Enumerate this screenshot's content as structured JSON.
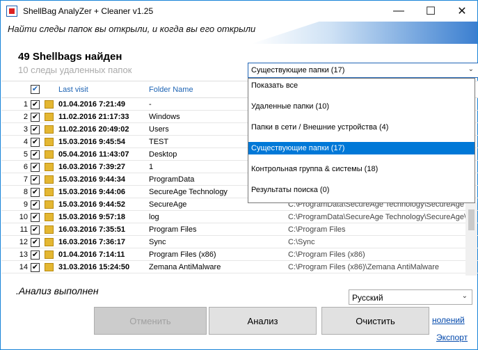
{
  "window": {
    "title": "ShellBag  AnalyZer + Cleaner v1.25"
  },
  "header": {
    "subtitle": "Найти следы папок вы открыли, и когда вы его открыли",
    "count_title": "49 Shellbags найден",
    "deleted_count": "10  следы удаленных папок"
  },
  "grid": {
    "col_last_visit": "Last visit",
    "col_folder_name": "Folder Name",
    "header_check": "✔",
    "rows": [
      {
        "n": "1",
        "visit": "01.04.2016 7:21:49",
        "name": "-",
        "path": ""
      },
      {
        "n": "2",
        "visit": "11.02.2016 21:17:33",
        "name": "Windows",
        "path": ""
      },
      {
        "n": "3",
        "visit": "11.02.2016 20:49:02",
        "name": "Users",
        "path": ""
      },
      {
        "n": "4",
        "visit": "15.03.2016 9:45:54",
        "name": "TEST",
        "path": ""
      },
      {
        "n": "5",
        "visit": "05.04.2016 11:43:07",
        "name": "Desktop",
        "path": ""
      },
      {
        "n": "6",
        "visit": "16.03.2016 7:39:27",
        "name": "1",
        "path": ""
      },
      {
        "n": "7",
        "visit": "15.03.2016 9:44:34",
        "name": "ProgramData",
        "path": ""
      },
      {
        "n": "8",
        "visit": "15.03.2016 9:44:06",
        "name": "SecureAge Technology",
        "path": ""
      },
      {
        "n": "9",
        "visit": "15.03.2016 9:44:52",
        "name": "SecureAge",
        "path": "C:\\ProgramData\\SecureAge Technology\\SecureAge"
      },
      {
        "n": "10",
        "visit": "15.03.2016 9:57:18",
        "name": "log",
        "path": "C:\\ProgramData\\SecureAge Technology\\SecureAge\\lo"
      },
      {
        "n": "11",
        "visit": "16.03.2016 7:35:51",
        "name": "Program Files",
        "path": "C:\\Program Files"
      },
      {
        "n": "12",
        "visit": "16.03.2016 7:36:17",
        "name": "Sync",
        "path": "C:\\Sync"
      },
      {
        "n": "13",
        "visit": "01.04.2016 7:14:11",
        "name": "Program Files (x86)",
        "path": "C:\\Program Files (x86)"
      },
      {
        "n": "14",
        "visit": "31.03.2016 15:24:50",
        "name": "Zemana AntiMalware",
        "path": "C:\\Program Files (x86)\\Zemana AntiMalware"
      }
    ]
  },
  "filter": {
    "selected": "Существующие папки   (17)",
    "options": [
      "Показать все",
      "Удаленные папки   (10)",
      "Папки в сети / Внешние устройства   (4)",
      "Существующие папки   (17)",
      "Контрольная группа & системы   (18)",
      "Результаты поиска   (0)"
    ],
    "selected_index": 3
  },
  "footer": {
    "status": ".Анализ выполнен",
    "language": "Русский",
    "cancel_label": "Отменить",
    "analyze_label": "Анализ",
    "clean_label": "Очистить",
    "link_deleted": "нолений",
    "link_export": "Экспорт"
  }
}
